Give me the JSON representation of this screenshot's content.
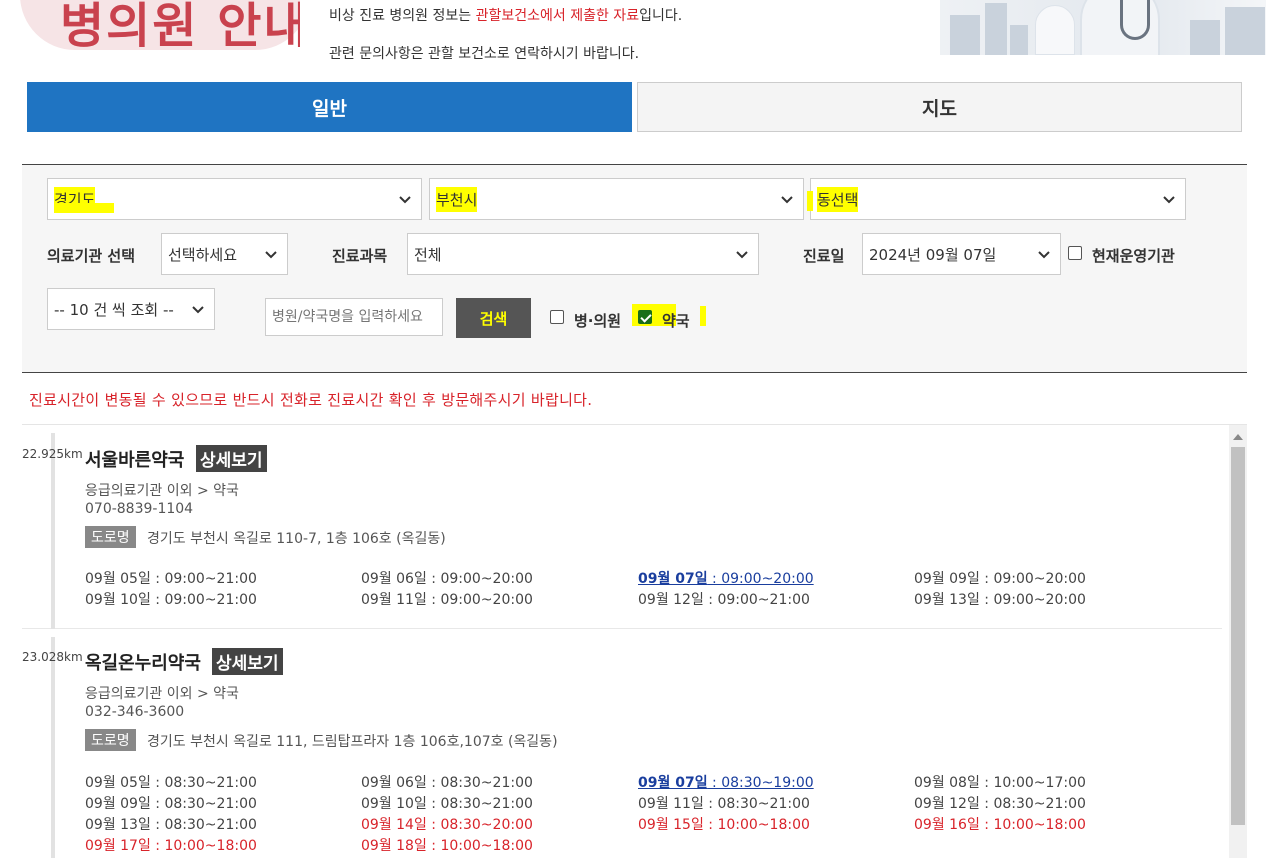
{
  "header": {
    "logo_text": "병의원 안내",
    "notice1_pre": "비상 진료 병의원 정보는 ",
    "notice1_red": "관할보건소에서 제출한 자료",
    "notice1_post": "입니다.",
    "notice2": "관련 문의사항은 관할 보건소로 연락하시기 바랍니다."
  },
  "tabs": {
    "general": "일반",
    "map": "지도"
  },
  "search": {
    "province": "경기도",
    "city": "부천시",
    "dong": "동선택",
    "institution_label": "의료기관 선택",
    "institution_value": "선택하세요",
    "department_label": "진료과목",
    "department_value": "전체",
    "date_label": "진료일",
    "date_value": "2024년 09월 07일",
    "open_now_label": "현재운영기관",
    "page_size": "-- 10 건 씩 조회 --",
    "name_placeholder": "병원/약국명을 입력하세요",
    "search_button": "검색",
    "hospital_label": "병·의원",
    "pharmacy_label": "약국",
    "hospital_checked": false,
    "pharmacy_checked": true,
    "open_now_checked": false
  },
  "warning": "진료시간이 변동될 수 있으므로 반드시 전화로 진료시간 확인 후 방문해주시기 바랍니다.",
  "results": [
    {
      "distance": "22.925km",
      "name": "서울바른약국",
      "detail": "상세보기",
      "category": "응급의료기관 이외 > 약국",
      "phone": "070-8839-1104",
      "road_tag": "도로명",
      "address": "경기도 부천시 옥길로 110-7, 1층 106호 (옥길동)",
      "hours": [
        {
          "day": "09월 05일",
          "time": " : 09:00~21:00",
          "style": "normal"
        },
        {
          "day": "09월 06일",
          "time": " : 09:00~20:00",
          "style": "normal"
        },
        {
          "day": "09월 07일",
          "time": " : 09:00~20:00",
          "style": "today"
        },
        {
          "day": "09월 09일",
          "time": " : 09:00~20:00",
          "style": "normal"
        },
        {
          "day": "09월 10일",
          "time": " : 09:00~21:00",
          "style": "normal"
        },
        {
          "day": "09월 11일",
          "time": " : 09:00~20:00",
          "style": "normal"
        },
        {
          "day": "09월 12일",
          "time": " : 09:00~21:00",
          "style": "normal"
        },
        {
          "day": "09월 13일",
          "time": " : 09:00~20:00",
          "style": "normal"
        }
      ]
    },
    {
      "distance": "23.028km",
      "name": "옥길온누리약국",
      "detail": "상세보기",
      "category": "응급의료기관 이외 > 약국",
      "phone": "032-346-3600",
      "road_tag": "도로명",
      "address": "경기도 부천시 옥길로 111, 드림탑프라자 1층 106호,107호 (옥길동)",
      "hours": [
        {
          "day": "09월 05일",
          "time": " : 08:30~21:00",
          "style": "normal"
        },
        {
          "day": "09월 06일",
          "time": " : 08:30~21:00",
          "style": "normal"
        },
        {
          "day": "09월 07일",
          "time": " : 08:30~19:00",
          "style": "today"
        },
        {
          "day": "09월 08일",
          "time": " : 10:00~17:00",
          "style": "normal"
        },
        {
          "day": "09월 09일",
          "time": " : 08:30~21:00",
          "style": "normal"
        },
        {
          "day": "09월 10일",
          "time": " : 08:30~21:00",
          "style": "normal"
        },
        {
          "day": "09월 11일",
          "time": " : 08:30~21:00",
          "style": "normal"
        },
        {
          "day": "09월 12일",
          "time": " : 08:30~21:00",
          "style": "normal"
        },
        {
          "day": "09월 13일",
          "time": " : 08:30~21:00",
          "style": "normal"
        },
        {
          "day": "09월 14일",
          "time": " : 08:30~20:00",
          "style": "red"
        },
        {
          "day": "09월 15일",
          "time": " : 10:00~18:00",
          "style": "red"
        },
        {
          "day": "09월 16일",
          "time": " : 10:00~18:00",
          "style": "red"
        },
        {
          "day": "09월 17일",
          "time": " : 10:00~18:00",
          "style": "red"
        },
        {
          "day": "09월 18일",
          "time": " : 10:00~18:00",
          "style": "red"
        }
      ]
    }
  ],
  "colors": {
    "tab_active": "#1f74c2",
    "highlight": "#ffff00",
    "warning": "#d8232a",
    "today": "#1a3e9e"
  }
}
